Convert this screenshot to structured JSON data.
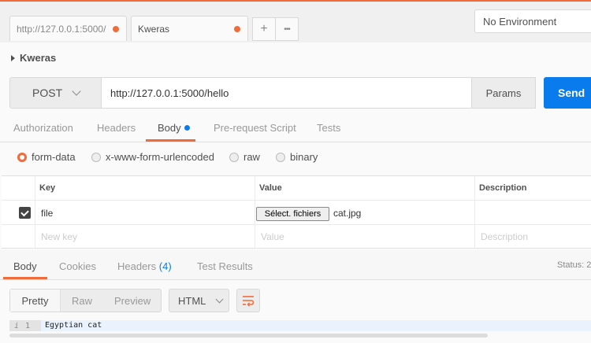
{
  "tabs": [
    {
      "label": "http://127.0.0.1:5000/"
    },
    {
      "label": "Kweras"
    }
  ],
  "tab_actions": {
    "add_icon": "+",
    "more_icon": "•••"
  },
  "environment": {
    "selected": "No Environment"
  },
  "collection": {
    "name": "Kweras"
  },
  "request": {
    "method": "POST",
    "url": "http://127.0.0.1:5000/hello",
    "params_label": "Params",
    "send_label": "Send"
  },
  "request_tabs": [
    "Authorization",
    "Headers",
    "Body",
    "Pre-request Script",
    "Tests"
  ],
  "body_types": [
    "form-data",
    "x-www-form-urlencoded",
    "raw",
    "binary"
  ],
  "form_table": {
    "headers": [
      "Key",
      "Value",
      "Description"
    ],
    "rows": [
      {
        "key": "file",
        "button": "Sélect. fichiers",
        "file_name": "cat.jpg",
        "checked": true
      }
    ],
    "placeholders": {
      "key": "New key",
      "value": "Value",
      "description": "Description"
    }
  },
  "response": {
    "tabs": {
      "body": "Body",
      "cookies": "Cookies",
      "headers": "Headers",
      "headers_count": "(4)",
      "tests": "Test Results"
    },
    "status_label": "Status: 2",
    "formats": [
      "Pretty",
      "Raw",
      "Preview"
    ],
    "language": "HTML",
    "line_number": "1",
    "content": "Egyptian cat"
  },
  "colors": {
    "accent": "#f26b3a",
    "send": "#097bed"
  }
}
